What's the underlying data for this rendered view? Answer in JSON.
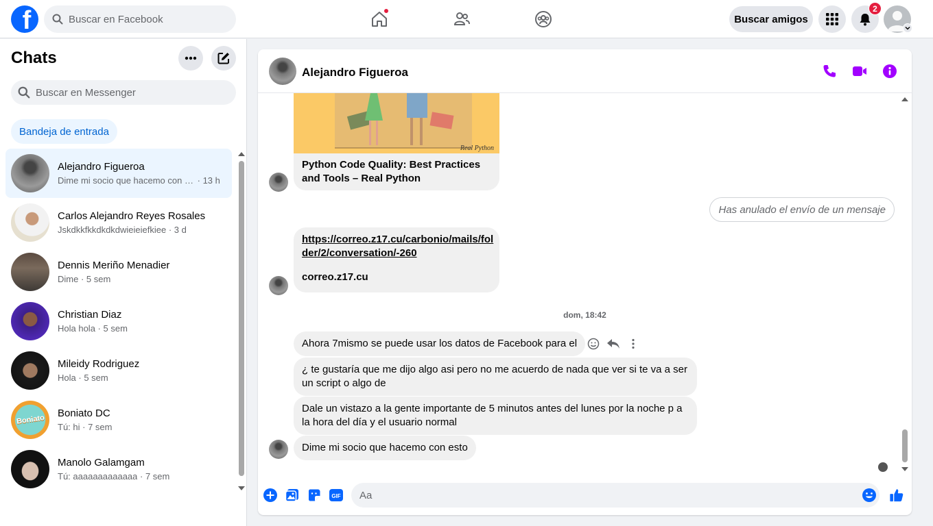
{
  "topbar": {
    "logo_letter": "f",
    "search_placeholder": "Buscar en Facebook",
    "find_friends_label": "Buscar amigos",
    "notifications_count": "2",
    "nav_icons": [
      "home-icon",
      "friends-icon",
      "groups-icon"
    ],
    "accent_color": "#0866ff"
  },
  "sidebar": {
    "title": "Chats",
    "search_placeholder": "Buscar en Messenger",
    "inbox_label": "Bandeja de entrada",
    "chats": [
      {
        "name": "Alejandro Figueroa",
        "preview": "Dime mi socio que hacemo con e...",
        "time": "13 h",
        "active": true
      },
      {
        "name": "Carlos Alejandro Reyes Rosales",
        "preview": "Jskdkkfkkdkdkdwieieiefkiee",
        "time": "3 d"
      },
      {
        "name": "Dennis Meriño Menadier",
        "preview": "Dime",
        "time": "5 sem"
      },
      {
        "name": "Christian Diaz",
        "preview": "Hola hola",
        "time": "5 sem"
      },
      {
        "name": "Mileidy Rodriguez",
        "preview": "Hola",
        "time": "5 sem"
      },
      {
        "name": "Boniato DC",
        "preview": "Tú: hi",
        "time": "7 sem"
      },
      {
        "name": "Manolo Galamgam",
        "preview": "Tú: aaaaaaaaaaaaa",
        "time": "7 sem"
      }
    ],
    "boniato_logo_text": "Boniato"
  },
  "conversation": {
    "contact_name": "Alejandro Figueroa",
    "link_card_title": "Python Code Quality: Best Practices and Tools – Real Python",
    "link_card_watermark": "Real Python",
    "unsent_notice": "Has anulado el envío de un mensaje",
    "link_url": "https://correo.z17.cu/carbonio/mails/folder/2/conversation/-260",
    "link_url_line1": "https://correo.z17.cu/carbonio/mails/fol",
    "link_url_line2": "der/2/conversation/-260",
    "link_domain": "correo.z17.cu",
    "timestamp": "dom, 18:42",
    "messages": [
      "Ahora 7mismo se puede usar los datos de Facebook para el",
      "¿ te gustaría que me dijo algo asi pero no me acuerdo de nada que ver si te va a ser un script o algo de",
      "Dale un vistazo a la gente importante de 5 minutos antes del lunes por la noche p a la hora del día y el usuario normal",
      "Dime mi socio que hacemo con esto"
    ],
    "composer_placeholder": "Aa",
    "header_icons_color": "#a200ff",
    "composer_icons_color": "#0866ff"
  }
}
